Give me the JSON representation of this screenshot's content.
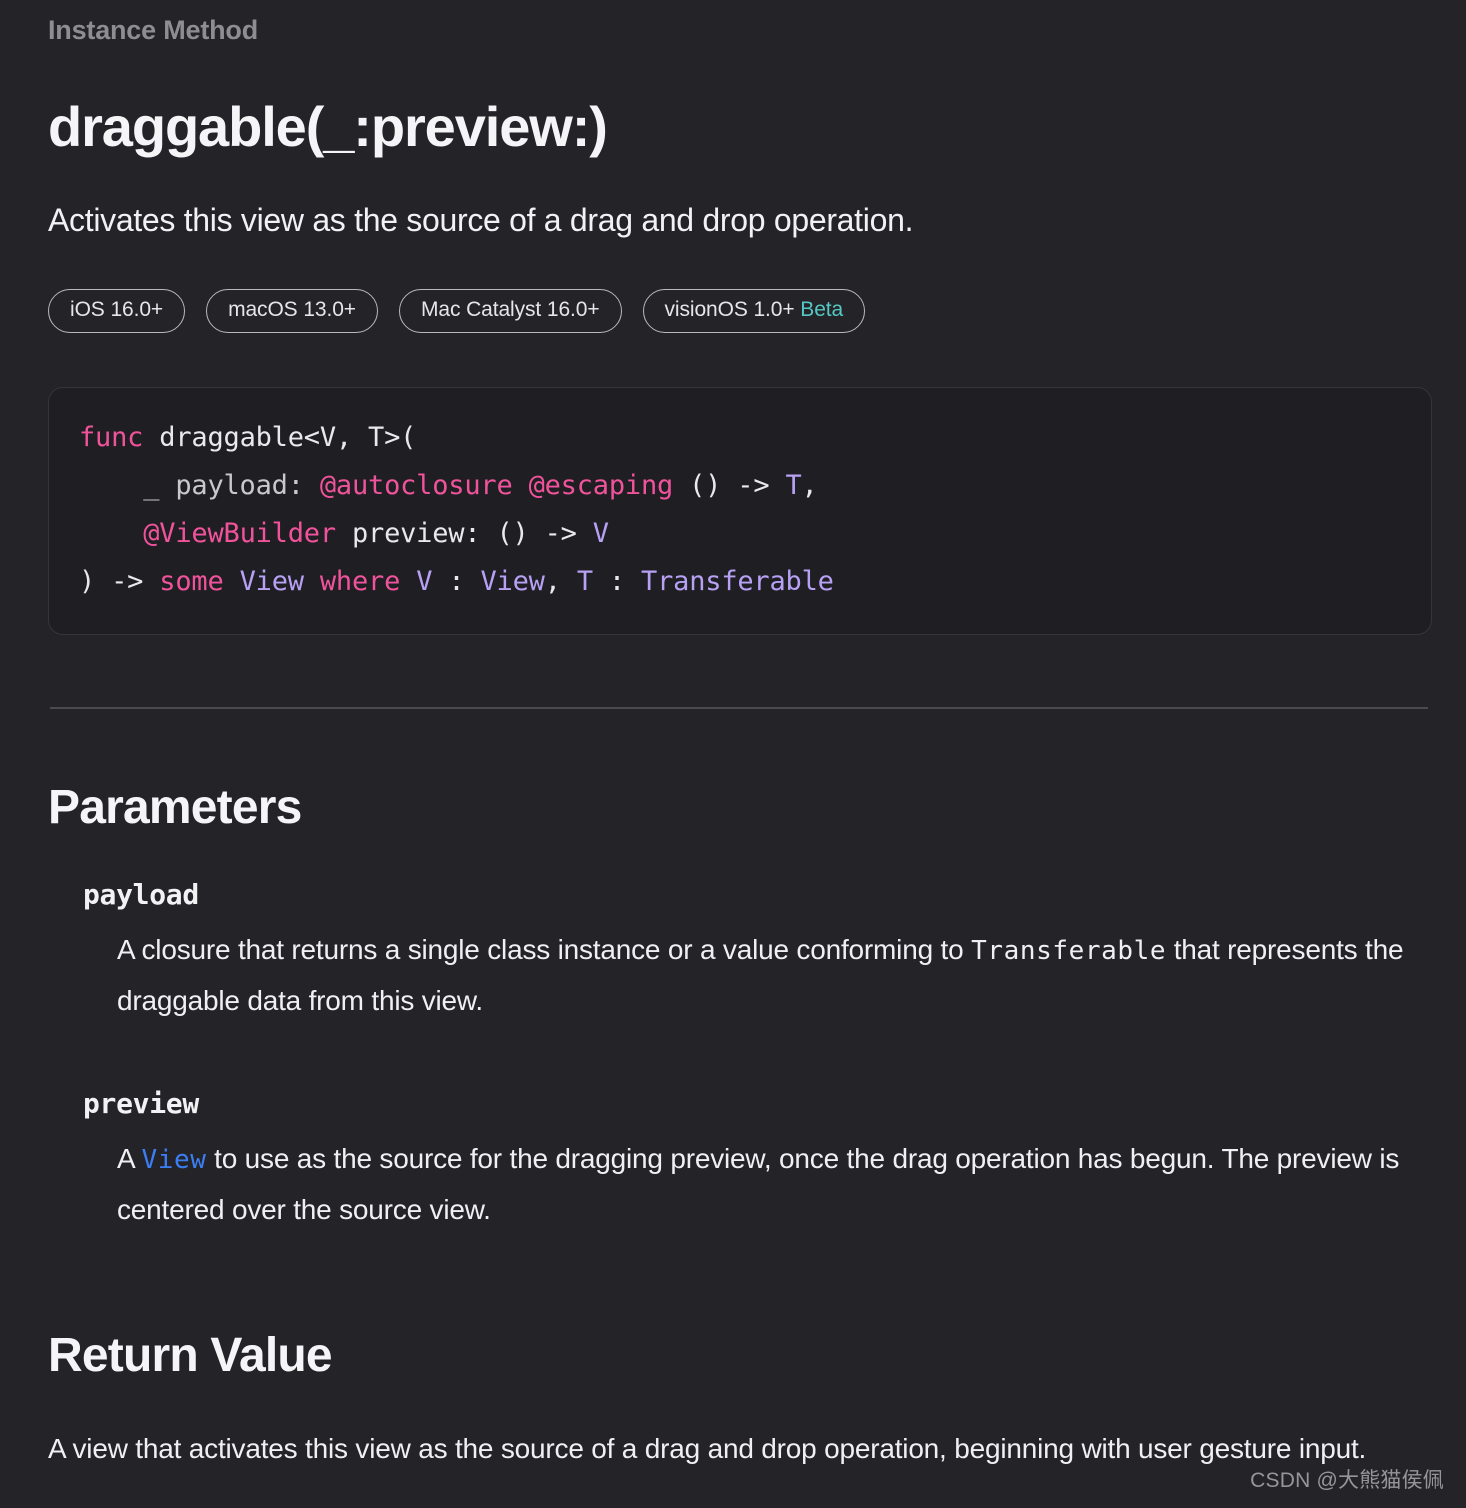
{
  "page": {
    "background_color": "#242428",
    "eyebrow": "Instance Method",
    "title": "draggable(_:preview:)",
    "abstract": "Activates this view as the source of a drag and drop operation."
  },
  "availability": {
    "beta_label": "Beta",
    "beta_color": "#54c8c4",
    "platforms": [
      {
        "label": "iOS 16.0+",
        "beta": ""
      },
      {
        "label": "macOS 13.0+",
        "beta": ""
      },
      {
        "label": "Mac Catalyst 16.0+",
        "beta": ""
      },
      {
        "label": "visionOS 1.0+",
        "beta": "Beta"
      }
    ]
  },
  "declaration": {
    "background_color": "#1f1f23",
    "keyword_color": "#f0539c",
    "type_color": "#b8a1f5",
    "text_color": "#e9e9ec",
    "lines": [
      {
        "tokens": [
          {
            "t": "func",
            "c": "kw"
          },
          {
            "t": " draggable<V, T>(",
            "c": "plain"
          }
        ]
      },
      {
        "tokens": [
          {
            "t": "    _ payload: ",
            "c": "param-nm"
          },
          {
            "t": "@autoclosure @escaping",
            "c": "attr"
          },
          {
            "t": " () -> ",
            "c": "plain"
          },
          {
            "t": "T",
            "c": "type"
          },
          {
            "t": ",",
            "c": "plain"
          }
        ]
      },
      {
        "tokens": [
          {
            "t": "    ",
            "c": "plain"
          },
          {
            "t": "@ViewBuilder",
            "c": "attr"
          },
          {
            "t": " preview: () -> ",
            "c": "plain"
          },
          {
            "t": "V",
            "c": "type"
          }
        ]
      },
      {
        "tokens": [
          {
            "t": ") -> ",
            "c": "plain"
          },
          {
            "t": "some",
            "c": "kw"
          },
          {
            "t": " ",
            "c": "plain"
          },
          {
            "t": "View",
            "c": "type"
          },
          {
            "t": " ",
            "c": "plain"
          },
          {
            "t": "where",
            "c": "kw"
          },
          {
            "t": " ",
            "c": "plain"
          },
          {
            "t": "V",
            "c": "type"
          },
          {
            "t": " : ",
            "c": "plain"
          },
          {
            "t": "View",
            "c": "type"
          },
          {
            "t": ", ",
            "c": "plain"
          },
          {
            "t": "T",
            "c": "type"
          },
          {
            "t": " : ",
            "c": "plain"
          },
          {
            "t": "Transferable",
            "c": "type"
          }
        ]
      }
    ],
    "plain_text": "func draggable<V, T>(\n    _ payload: @autoclosure @escaping () -> T,\n    @ViewBuilder preview: () -> V\n) -> some View where V : View, T : Transferable"
  },
  "parameters_section": {
    "heading": "Parameters",
    "items": [
      {
        "name": "payload",
        "desc_before": "A closure that returns a single class instance or a value conforming to ",
        "desc_code": "Transferable",
        "desc_after": " that represents the draggable data from this view.",
        "link": ""
      },
      {
        "name": "preview",
        "desc_before": "A ",
        "desc_code": "View",
        "desc_after": " to use as the source for the dragging preview, once the drag operation has begun. The preview is centered over the source view.",
        "link": "View"
      }
    ]
  },
  "return_section": {
    "heading": "Return Value",
    "text": "A view that activates this view as the source of a drag and drop operation, beginning with user gesture input."
  },
  "watermark": {
    "text": "CSDN @大熊猫侯佩"
  }
}
